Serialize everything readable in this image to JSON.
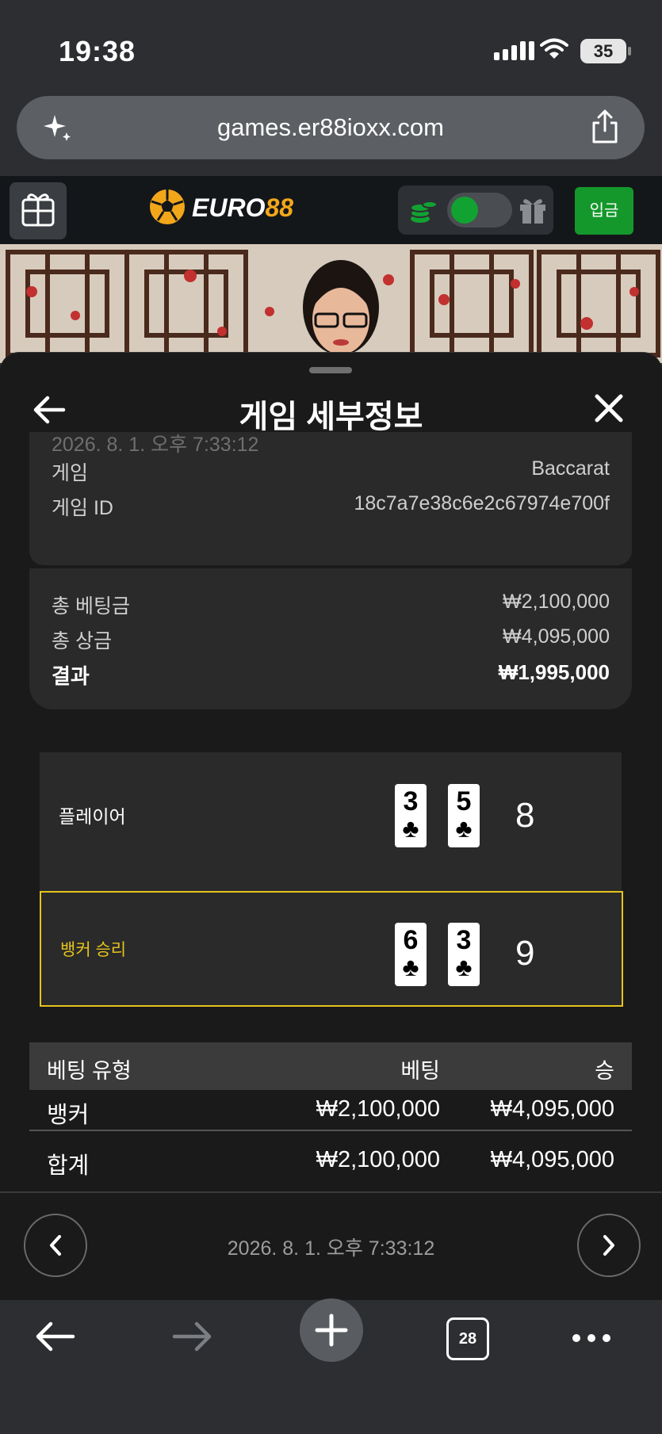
{
  "status_bar": {
    "time": "19:38",
    "battery": "35"
  },
  "browser": {
    "url": "games.er88ioxx.com",
    "tab_count": "28"
  },
  "site": {
    "logo": "EURO88",
    "logo_prefix": "EURO",
    "logo_suffix": "88",
    "deposit_label": "입금"
  },
  "sheet": {
    "title": "게임 세부정보",
    "timestamp_cut": "2026. 8. 1. 오후 7:33:12",
    "game_label": "게임",
    "game_value": "Baccarat",
    "game_id_label": "게임 ID",
    "game_id_value": "18c7a7e38c6e2c67974e700f",
    "total_bet_label": "총 베팅금",
    "total_bet_value": "₩2,100,000",
    "total_prize_label": "총 상금",
    "total_prize_value": "₩4,095,000",
    "result_label": "결과",
    "result_value": "₩1,995,000"
  },
  "hands": {
    "player": {
      "label": "플레이어",
      "cards": [
        {
          "rank": "3",
          "suit": "♣"
        },
        {
          "rank": "5",
          "suit": "♣"
        }
      ],
      "score": "8"
    },
    "banker": {
      "label": "뱅커 승리",
      "cards": [
        {
          "rank": "6",
          "suit": "♣"
        },
        {
          "rank": "3",
          "suit": "♣"
        }
      ],
      "score": "9"
    },
    "winner_color": "#e7c31c"
  },
  "bets_table": {
    "headers": {
      "type": "베팅 유형",
      "bet": "베팅",
      "win": "승"
    },
    "rows": [
      {
        "type": "뱅커",
        "bet": "₩2,100,000",
        "win": "₩4,095,000"
      }
    ],
    "total": {
      "type": "합계",
      "bet": "₩2,100,000",
      "win": "₩4,095,000"
    }
  },
  "footer_nav": {
    "date": "2026. 8. 1. 오후 7:33:12"
  },
  "colors": {
    "accent_green": "#14982c",
    "brand_gold": "#f2a71b",
    "winner_border": "#e7c31c"
  }
}
